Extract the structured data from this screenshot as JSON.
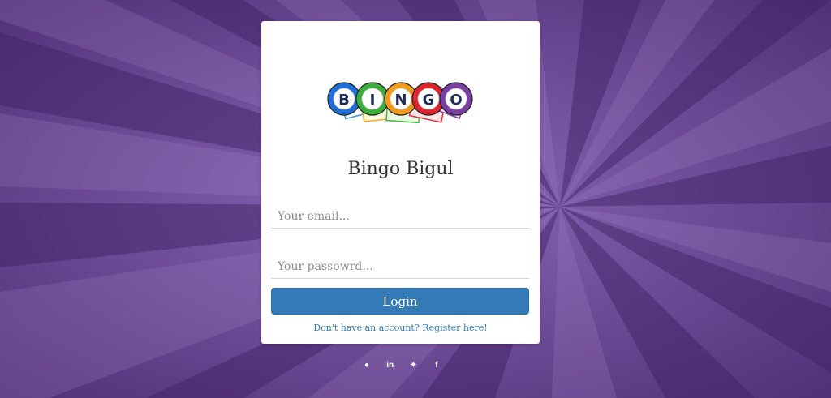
{
  "app": {
    "title": "Bingo Bigul",
    "logo_letters": [
      "B",
      "I",
      "N",
      "G",
      "O"
    ]
  },
  "form": {
    "email_placeholder": "Your email...",
    "password_placeholder": "Your passowrd...",
    "login_label": "Login",
    "register_link": "Don't have an account? Register here!"
  },
  "social": [
    {
      "icon": "github-icon",
      "glyph": "●"
    },
    {
      "icon": "linkedin-icon",
      "glyph": "in"
    },
    {
      "icon": "twitter-icon",
      "glyph": "✦"
    },
    {
      "icon": "facebook-icon",
      "glyph": "f"
    }
  ],
  "colors": {
    "background": "#6b4597",
    "card": "#ffffff",
    "primary": "#337ab7",
    "ball_blue": "#1e6fd9",
    "ball_green": "#3cae3a",
    "ball_orange": "#f29a1a",
    "ball_red": "#e0242e",
    "ball_purple": "#7b3fa3"
  }
}
